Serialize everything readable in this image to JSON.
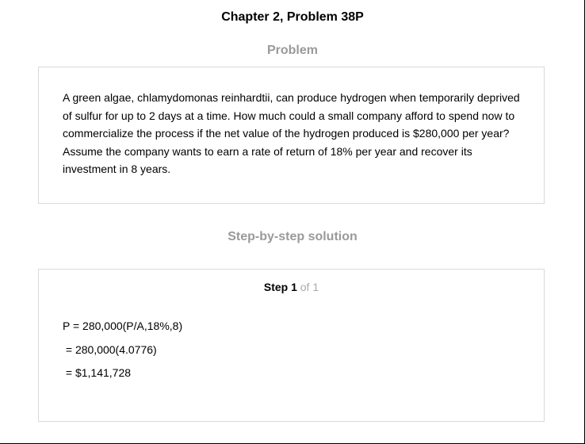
{
  "header": {
    "title": "Chapter 2, Problem 38P"
  },
  "problem": {
    "heading": "Problem",
    "text": "A green algae, chlamydomonas reinhardtii, can produce hydrogen when temporarily deprived of sulfur for up to 2 days at a time. How much could a small company afford to spend now to commercialize the process if the net value of the hydrogen produced is $280,000 per year? Assume the company wants to earn a rate of return of 18% per year and recover its investment in 8 years."
  },
  "solution": {
    "heading": "Step-by-step solution",
    "step_label": "Step 1",
    "step_of": "of 1",
    "lines": [
      "P = 280,000(P/A,18%,8)",
      " = 280,000(4.0776)",
      " = $1,141,728"
    ]
  },
  "colors": {
    "heading_gray": "#9a9a9a",
    "box_border": "#d9d9d9",
    "step_of_gray": "#aaaaaa"
  }
}
